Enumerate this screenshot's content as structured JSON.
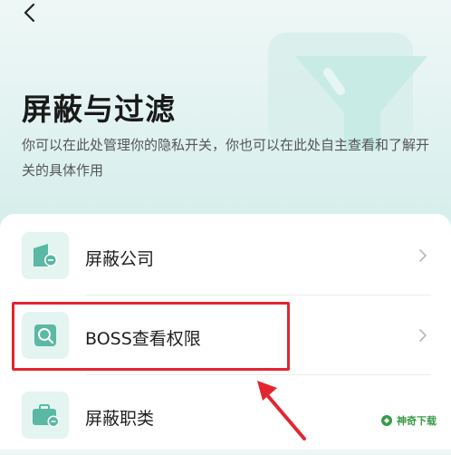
{
  "header": {
    "back_icon": "chevron-left-icon",
    "title": "屏蔽与过滤",
    "description": "你可以在此处管理你的隐私开关，你也可以在此处自主查看和了解开关的具体作用",
    "decoration_icon": "funnel-icon"
  },
  "settings": {
    "items": [
      {
        "label": "屏蔽公司",
        "icon": "company-block-icon"
      },
      {
        "label": "BOSS查看权限",
        "icon": "search-permission-icon"
      },
      {
        "label": "屏蔽职类",
        "icon": "briefcase-block-icon"
      }
    ]
  },
  "annotation": {
    "color": "#e3252f"
  },
  "watermark": {
    "text": "神奇下载"
  },
  "colors": {
    "accent_teal": "#5ab8a4",
    "icon_bg": "#e3f4f1",
    "highlight_red": "#e3252f"
  }
}
